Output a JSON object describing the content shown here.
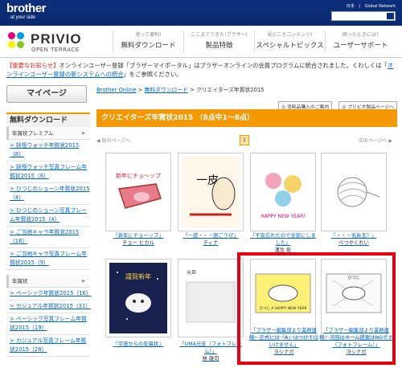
{
  "header": {
    "brand": "brother",
    "brand_tagline": "at your side",
    "lang_links": [
      "日本",
      "Global Network"
    ]
  },
  "nav": {
    "product_name": "PRIVIO",
    "product_sub": "OPEN TERRACE",
    "items": [
      {
        "small": "使って便利!",
        "big": "無料ダウンロード"
      },
      {
        "small": "ここまでできた!ブラザー!",
        "big": "製品特徴"
      },
      {
        "small": "見どころコンテンツ!",
        "big": "スペシャルトピックス"
      },
      {
        "small": "困ったときには?",
        "big": "ユーザーサポート"
      }
    ]
  },
  "notice": {
    "label": "【重要なお知らせ】",
    "text": "オンラインユーザー登録「ブラザーマイポータル」はブラザーオンラインの会員プログラムに統合されました。くわしくは「",
    "link": "オンラインユーザー登録の新システムへの統合",
    "tail": "」をご参照ください。"
  },
  "sidebar": {
    "mypage": "マイページ",
    "section_title": "無料ダウンロード",
    "categories": [
      {
        "name": "年賀状プレミアム",
        "links": [
          "> 妖怪ウォッチ年賀状2015（8）",
          "> 妖怪ウォッチ写真フレーム年賀状2015（6）",
          "> ひつじのショーン年賀状2015（4）",
          "> ひつじのショーン写真フレーム年賀状2015（4）",
          "> ご当地キャラ年賀状2015（18）",
          "> ご当地キャラ写真フレーム年賀状2015（9）"
        ]
      },
      {
        "name": "年賀状",
        "links": [
          "> ベーシック年賀状2015（16）",
          "> カジュアル年賀状2015（31）",
          "> ベーシック写真フレーム年賀状2015（19）",
          "> カジュアル写真フレーム年賀状2015（28）"
        ]
      }
    ]
  },
  "main": {
    "breadcrumb": [
      "Brother Online",
      "無料ダウンロード",
      "クリエイターズ年賀状2015"
    ],
    "util_buttons": [
      "◎ 消耗品購入のご案内",
      "◎ プリビオ製品ページへ"
    ],
    "banner": "クリエイターズ年賀状2015 （8点中1〜8点）",
    "pager": {
      "prev": "◀ 前のページへ",
      "current": "1",
      "next": "次のページへ ▶"
    },
    "cards": [
      {
        "title": "「新年にチョ〜ップ」",
        "author": "チョー ヒカル",
        "art": "meat",
        "art_text": "新年にチョ〜ップ"
      },
      {
        "title": "「一皮・・・脱ごうぜ」",
        "author": "ティナ",
        "art": "sheep-ink",
        "art_text": "一皮"
      },
      {
        "title": "「干支忘れたので全部にしました」",
        "author": "漢生 彰",
        "art": "animals",
        "art_text": "HAPPY NEW YEAR!"
      },
      {
        "title": "「・・・毛糸玉？」",
        "author": "べつやくれい",
        "art": "yarn",
        "art_text": ""
      },
      {
        "title": "「宇宙からの年賀状」",
        "author": "",
        "art": "space",
        "art_text": "謹賀新年"
      },
      {
        "title": "「UMA元旦（フォトフレーム）」",
        "author": "林 雄司",
        "art": "frame",
        "art_text": "元旦"
      },
      {
        "title": "「ブラザー編集部より業務連絡：正式には「A」はつけてはいけません」",
        "author": "ヨシナガ",
        "art": "yellow",
        "art_text": "ひつじ A HAPPY NEW YEAR"
      },
      {
        "title": "「ブラザー編集部より業務連絡：次回はネーム提案はNGです（フォトフレーム）」",
        "author": "ヨシナガ",
        "art": "sketch",
        "art_text": "ひつじ"
      }
    ]
  }
}
